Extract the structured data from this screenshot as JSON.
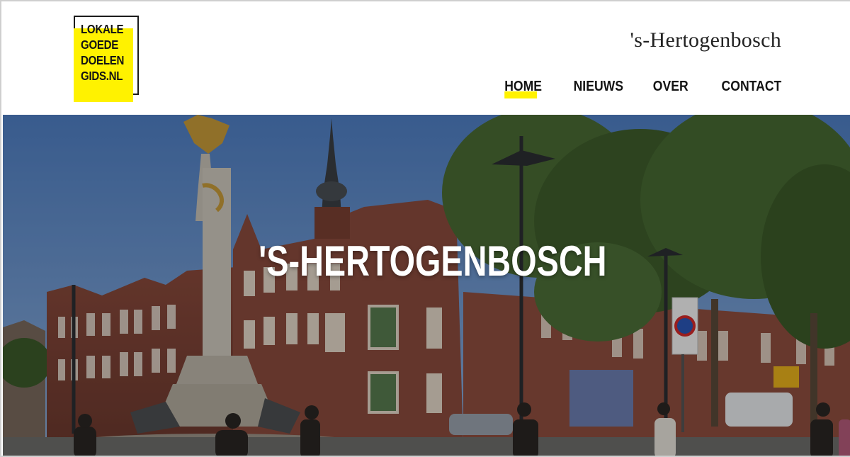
{
  "logo": {
    "lines": [
      "LOKALE",
      "GOEDE",
      "DOELEN",
      "GIDS.NL"
    ]
  },
  "header": {
    "site_title": "'s-Hertogenbosch"
  },
  "nav": {
    "items": [
      "HOME",
      "NIEUWS",
      "OVER",
      "CONTACT"
    ],
    "active": "HOME"
  },
  "hero": {
    "title": "'S-HERTOGENBOSCH"
  },
  "colors": {
    "accent": "#fff200",
    "text": "#141414"
  }
}
